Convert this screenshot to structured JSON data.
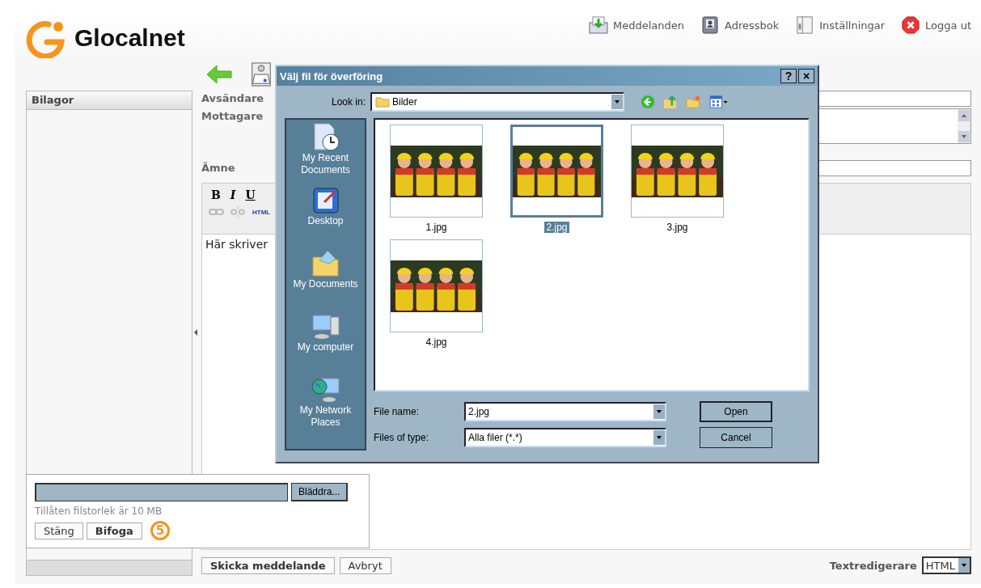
{
  "header": {
    "logo": "Glocalnet",
    "links": [
      {
        "label": "Meddelanden",
        "kind": "inbox"
      },
      {
        "label": "Adressbok",
        "kind": "book"
      },
      {
        "label": "Inställningar",
        "kind": "settings"
      },
      {
        "label": "Logga ut",
        "kind": "logout"
      }
    ]
  },
  "attachments_panel": {
    "title": "Bilagor"
  },
  "compose": {
    "fields": [
      {
        "label": "Avsändare",
        "kind": "line"
      },
      {
        "label": "Mottagare",
        "kind": "area"
      },
      {
        "label": "Ämne",
        "kind": "line"
      }
    ],
    "format_buttons": [
      "B",
      "I",
      "U"
    ],
    "html_button": "HTML",
    "body": "Här skriver",
    "buttons": [
      "Skicka meddelande",
      "Avbryt"
    ],
    "editor_label": "Textredigerare",
    "editor_mode": "HTML"
  },
  "upload": {
    "browse": "Bläddra...",
    "hint": "Tillåten filstorlek är 10 MB",
    "buttons": [
      "Stäng",
      "Bifoga"
    ],
    "step": "5"
  },
  "dialog": {
    "title": "Välj fil för överföring",
    "help": "?",
    "close": "×",
    "look_in_label": "Look in:",
    "look_in": "Bilder",
    "places": [
      {
        "label": "My Recent Documents",
        "kind": "recent"
      },
      {
        "label": "Desktop",
        "kind": "desktop"
      },
      {
        "label": "My Documents",
        "kind": "documents"
      },
      {
        "label": "My computer",
        "kind": "computer"
      },
      {
        "label": "My Network Places",
        "kind": "network"
      }
    ],
    "files": [
      {
        "name": "1.jpg",
        "selected": false
      },
      {
        "name": "2.jpg",
        "selected": true
      },
      {
        "name": "3.jpg",
        "selected": false
      },
      {
        "name": "4.jpg",
        "selected": false
      }
    ],
    "file_name_label": "File name:",
    "file_name": "2.jpg",
    "file_type_label": "Files of type:",
    "file_type": "Alla filer (*.*)",
    "open": "Open",
    "cancel": "Cancel"
  }
}
